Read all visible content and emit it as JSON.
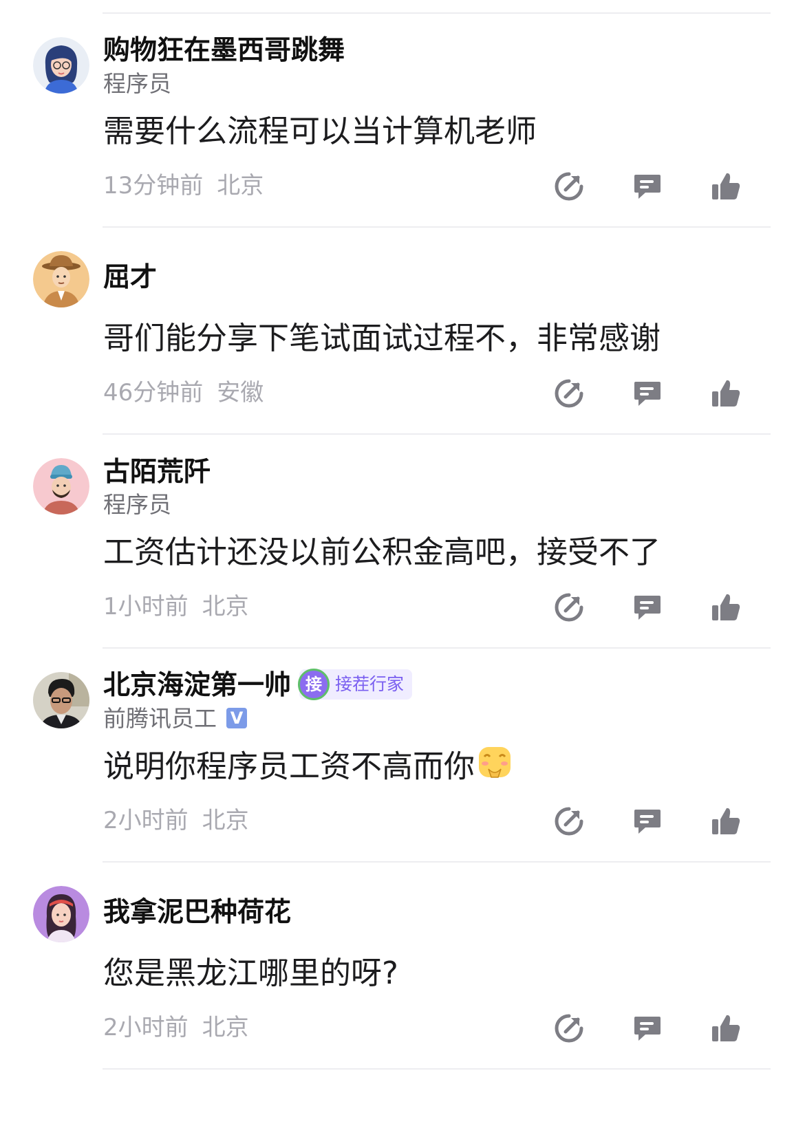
{
  "comments": [
    {
      "author": "购物狂在墨西哥跳舞",
      "title": "程序员",
      "text": "需要什么流程可以当计算机老师",
      "time": "13分钟前",
      "location": "北京"
    },
    {
      "author": "屈才",
      "title": "",
      "text": "哥们能分享下笔试面试过程不，非常感谢",
      "time": "46分钟前",
      "location": "安徽"
    },
    {
      "author": "古陌荒阡",
      "title": "程序员",
      "text": "工资估计还没以前公积金高吧，接受不了",
      "time": "1小时前",
      "location": "北京"
    },
    {
      "author": "北京海淀第一帅",
      "badge": {
        "icon_text": "接",
        "label": "接茬行家"
      },
      "title": "前腾讯员工",
      "verified_mark": "V",
      "text": "说明你程序员工资不高而你",
      "emoji": "smiling-blush-emoji",
      "time": "2小时前",
      "location": "北京"
    },
    {
      "author": "我拿泥巴种荷花",
      "title": "",
      "text": "您是黑龙江哪里的呀?",
      "time": "2小时前",
      "location": "北京"
    }
  ],
  "actions": {
    "share_icon": "share-arrow-icon",
    "reply_icon": "reply-bubble-icon",
    "like_icon": "thumbs-up-icon"
  },
  "colors": {
    "icon": "#7d7d84",
    "meta": "#a9a9b0",
    "divider": "#ededf0",
    "badge_bg": "#f0edff",
    "badge_text": "#7a5ff0"
  }
}
